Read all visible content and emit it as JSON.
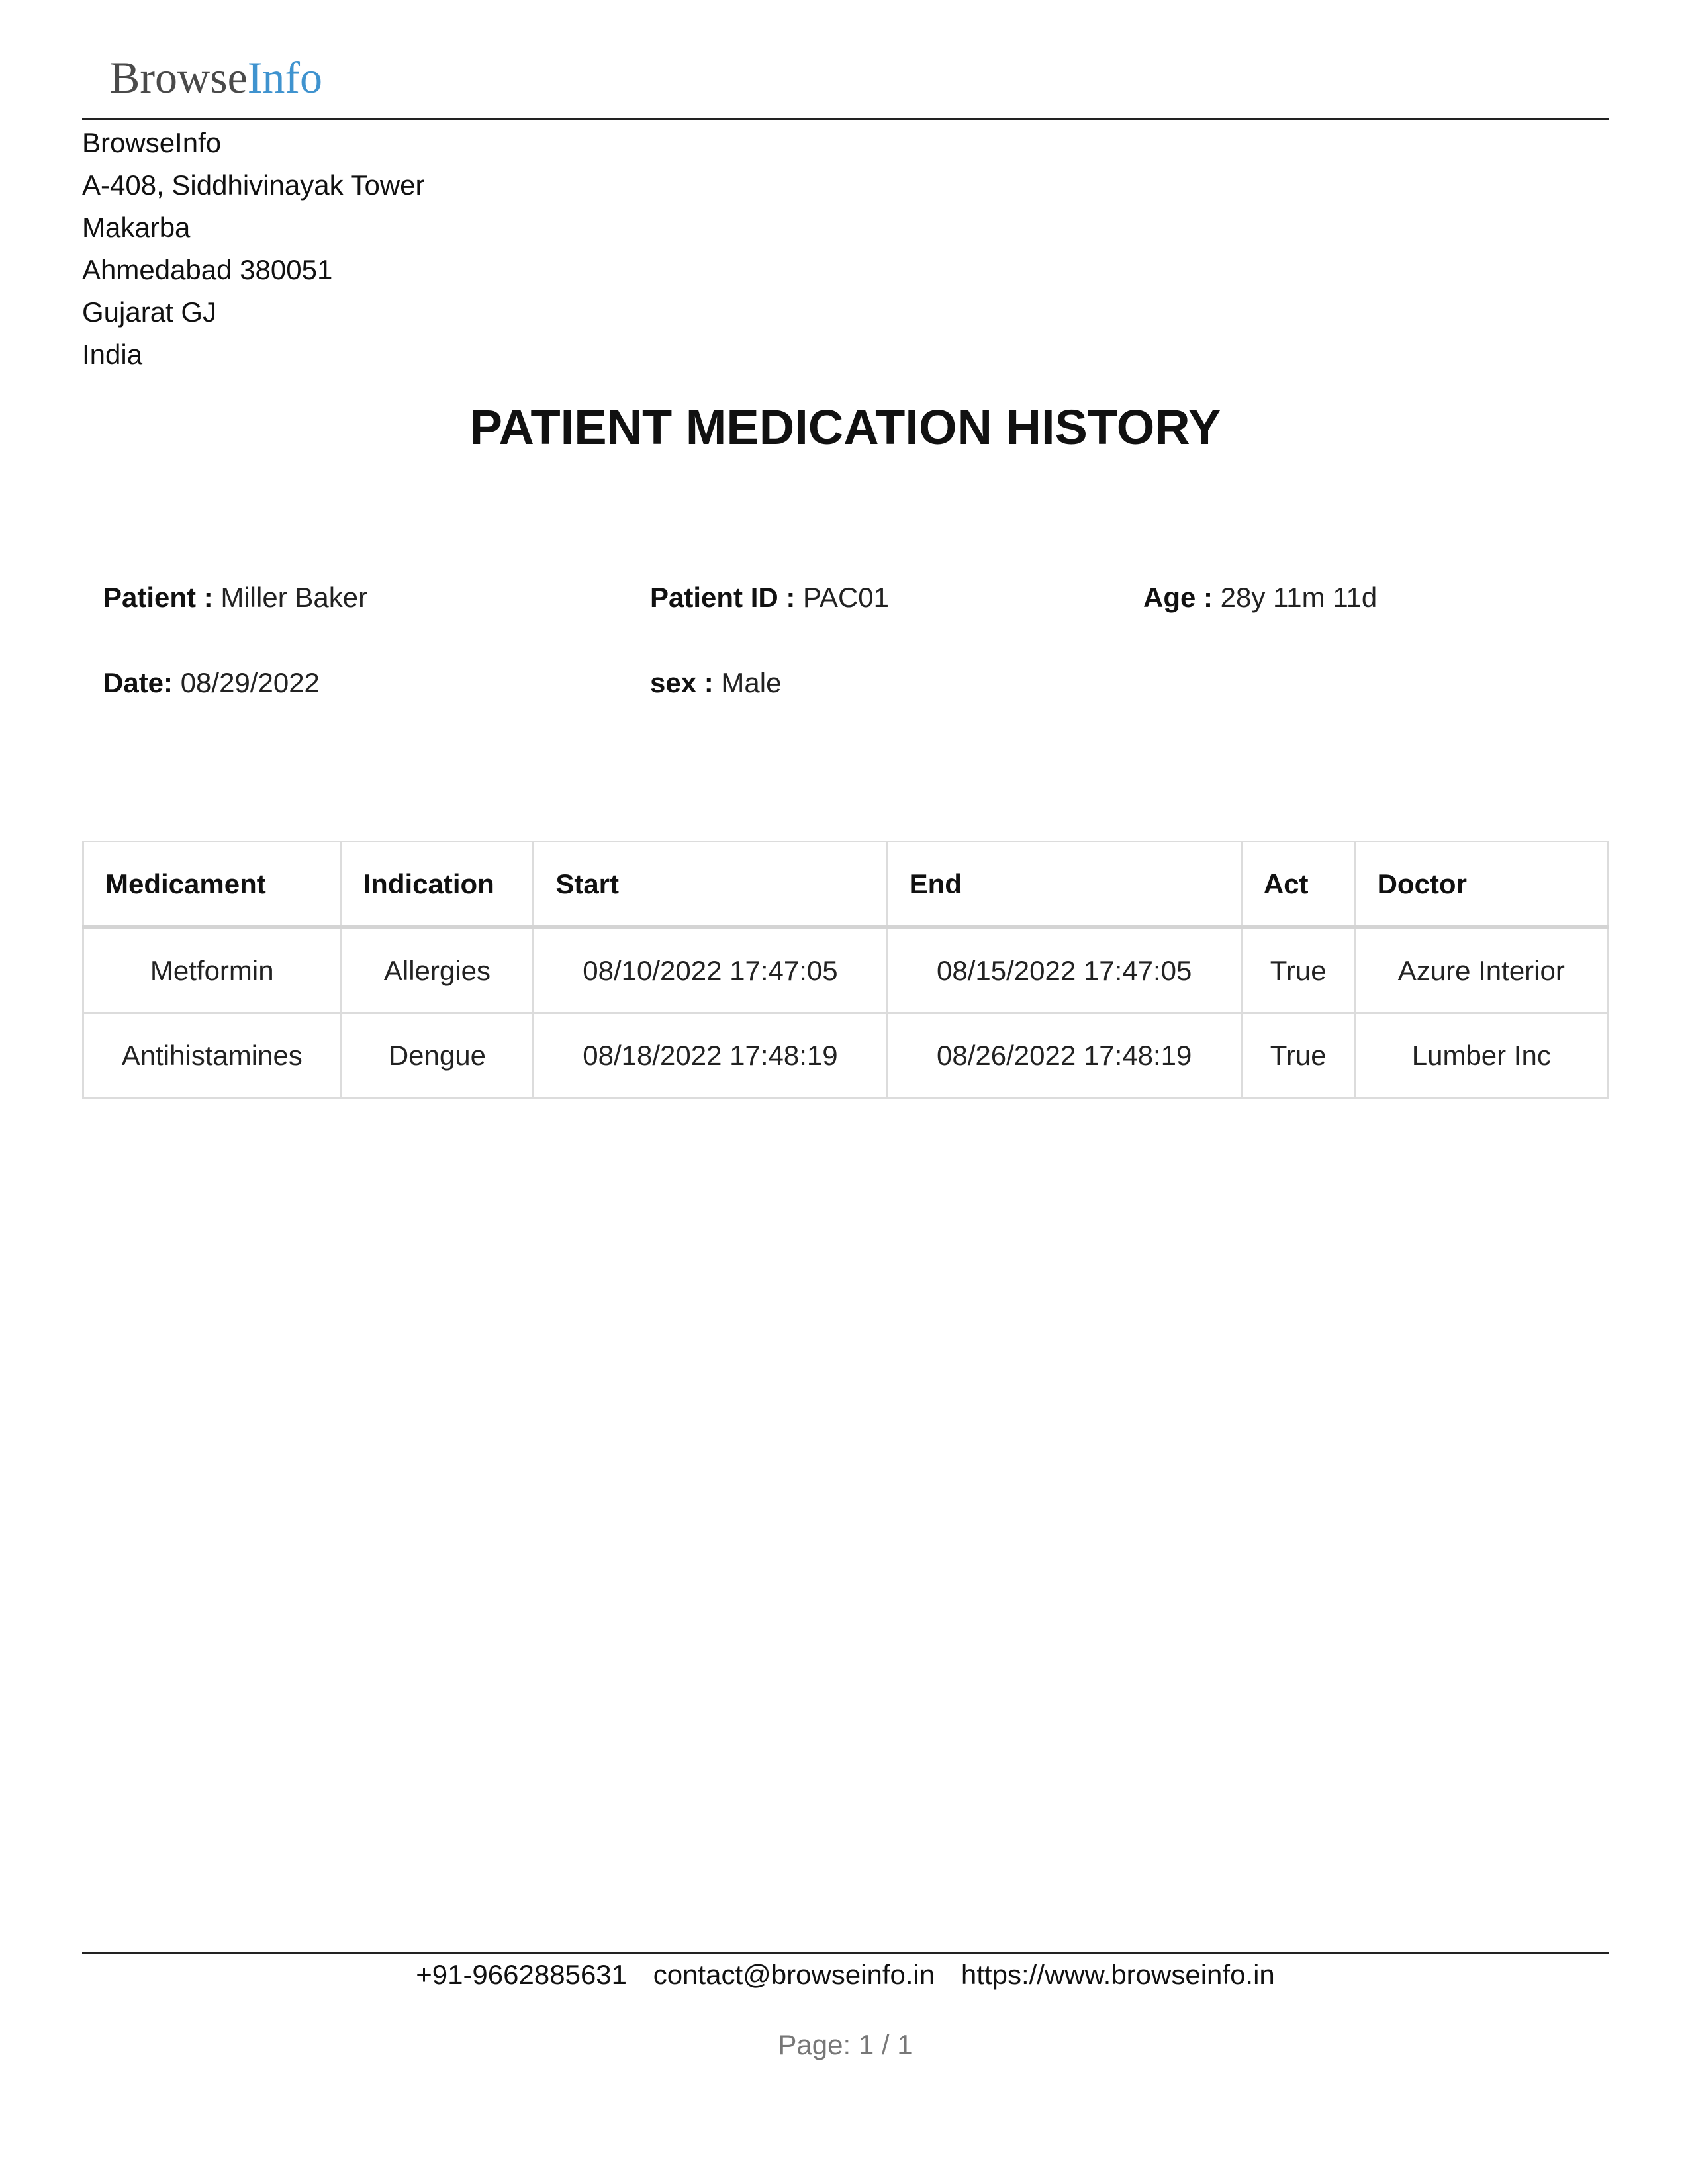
{
  "header": {
    "logo_part1": "Browse",
    "logo_part2": "Info",
    "logo_colors": {
      "browse": "#4a4a4a",
      "info": "#3f93cf"
    }
  },
  "company": {
    "name": "BrowseInfo",
    "street": "A-408, Siddhivinayak Tower",
    "area": "Makarba",
    "city_zip": "Ahmedabad 380051",
    "state": "Gujarat GJ",
    "country": "India"
  },
  "document": {
    "title": "PATIENT MEDICATION HISTORY"
  },
  "patient": {
    "name_label": "Patient :",
    "name": "Miller Baker",
    "id_label": "Patient ID :",
    "id": "PAC01",
    "age_label": "Age :",
    "age": "28y 11m 11d",
    "date_label": "Date:",
    "date": "08/29/2022",
    "sex_label": "sex :",
    "sex": "Male"
  },
  "table": {
    "headers": [
      "Medicament",
      "Indication",
      "Start",
      "End",
      "Act",
      "Doctor"
    ],
    "rows": [
      [
        "Metformin",
        "Allergies",
        "08/10/2022 17:47:05",
        "08/15/2022 17:47:05",
        "True",
        "Azure Interior"
      ],
      [
        "Antihistamines",
        "Dengue",
        "08/18/2022 17:48:19",
        "08/26/2022 17:48:19",
        "True",
        "Lumber Inc"
      ]
    ]
  },
  "footer": {
    "phone": "+91-9662885631",
    "email": "contact@browseinfo.in",
    "website": "https://www.browseinfo.in",
    "page": "Page: 1 / 1"
  }
}
